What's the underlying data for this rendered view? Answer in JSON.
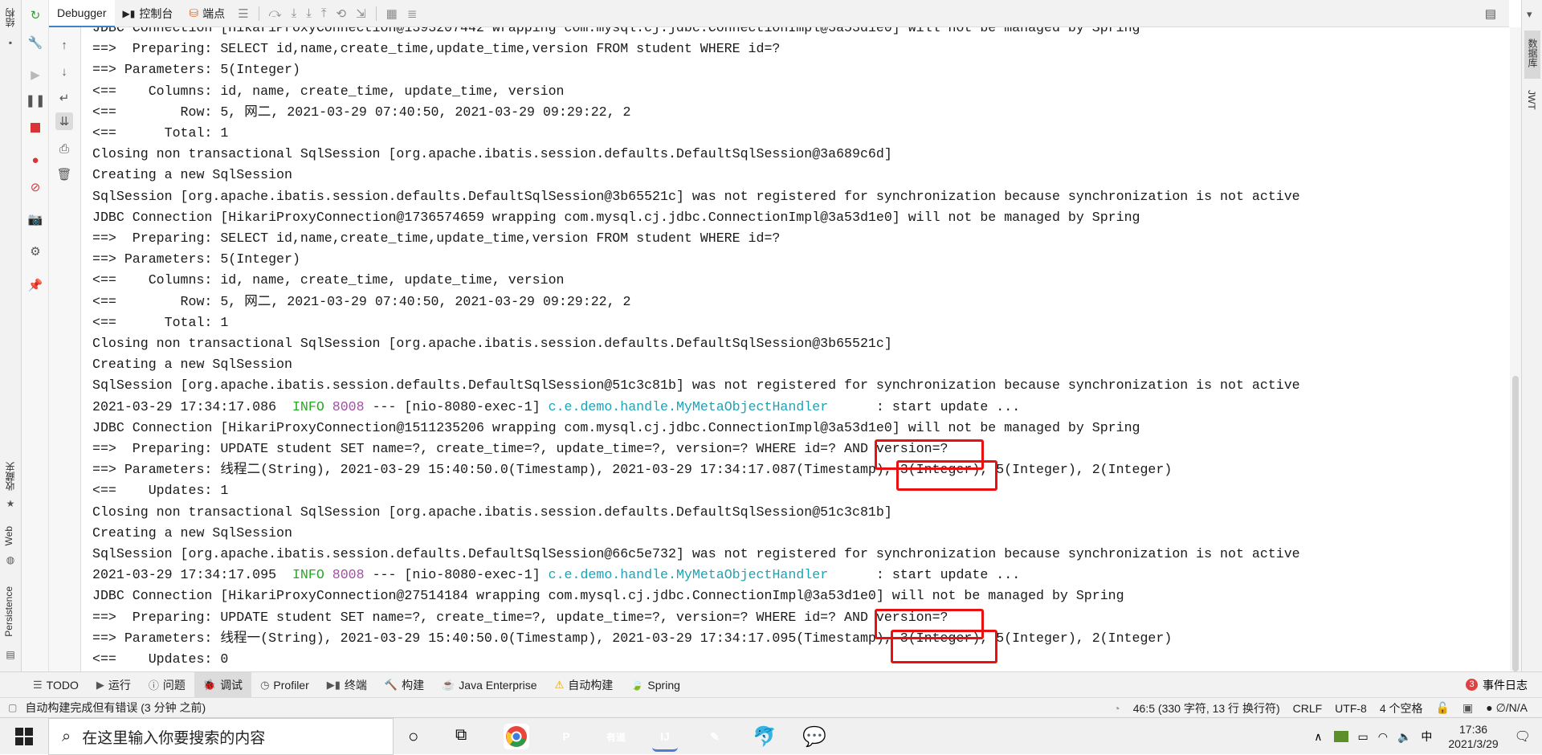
{
  "left_strip": {
    "top_label": "结构",
    "favorites_label": "收藏夹",
    "web_label": "Web",
    "persistence_label": "Persistence"
  },
  "debugger_tabs": {
    "debugger": "Debugger",
    "console": "控制台",
    "breakpoints": "端点"
  },
  "right_strip": {
    "database_label": "数据库",
    "jwt_label": "JWT"
  },
  "console_lines": [
    [
      {
        "t": "JDBC Connection [HikariProxyConnection@1393207442 wrapping com.mysql.cj.jdbc.ConnectionImpl@3a53d1e0] will not be managed by Spring"
      }
    ],
    [
      {
        "t": "==>  Preparing: SELECT id,name,create_time,update_time,version FROM student WHERE id=?"
      }
    ],
    [
      {
        "t": "==> Parameters: 5(Integer)"
      }
    ],
    [
      {
        "t": "<==    Columns: id, name, create_time, update_time, version"
      }
    ],
    [
      {
        "t": "<==        Row: 5, 网二, 2021-03-29 07:40:50, 2021-03-29 09:29:22, 2"
      }
    ],
    [
      {
        "t": "<==      Total: 1"
      }
    ],
    [
      {
        "t": "Closing non transactional SqlSession [org.apache.ibatis.session.defaults.DefaultSqlSession@3a689c6d]"
      }
    ],
    [
      {
        "t": "Creating a new SqlSession"
      }
    ],
    [
      {
        "t": "SqlSession [org.apache.ibatis.session.defaults.DefaultSqlSession@3b65521c] was not registered for synchronization because synchronization is not active"
      }
    ],
    [
      {
        "t": "JDBC Connection [HikariProxyConnection@1736574659 wrapping com.mysql.cj.jdbc.ConnectionImpl@3a53d1e0] will not be managed by Spring"
      }
    ],
    [
      {
        "t": "==>  Preparing: SELECT id,name,create_time,update_time,version FROM student WHERE id=?"
      }
    ],
    [
      {
        "t": "==> Parameters: 5(Integer)"
      }
    ],
    [
      {
        "t": "<==    Columns: id, name, create_time, update_time, version"
      }
    ],
    [
      {
        "t": "<==        Row: 5, 网二, 2021-03-29 07:40:50, 2021-03-29 09:29:22, 2"
      }
    ],
    [
      {
        "t": "<==      Total: 1"
      }
    ],
    [
      {
        "t": "Closing non transactional SqlSession [org.apache.ibatis.session.defaults.DefaultSqlSession@3b65521c]"
      }
    ],
    [
      {
        "t": "Creating a new SqlSession"
      }
    ],
    [
      {
        "t": "SqlSession [org.apache.ibatis.session.defaults.DefaultSqlSession@51c3c81b] was not registered for synchronization because synchronization is not active"
      }
    ],
    [
      {
        "t": "2021-03-29 17:34:17.086  "
      },
      {
        "t": "INFO",
        "c": "info"
      },
      {
        "t": " "
      },
      {
        "t": "8008",
        "c": "pid"
      },
      {
        "t": " --- [nio-8080-exec-1] "
      },
      {
        "t": "c.e.demo.handle.MyMetaObjectHandler",
        "c": "logger"
      },
      {
        "t": "      : start update ..."
      }
    ],
    [
      {
        "t": "JDBC Connection [HikariProxyConnection@1511235206 wrapping com.mysql.cj.jdbc.ConnectionImpl@3a53d1e0] will not be managed by Spring"
      }
    ],
    [
      {
        "t": "==>  Preparing: UPDATE student SET name=?, create_time=?, update_time=?, version=? WHERE id=? AND version=?"
      }
    ],
    [
      {
        "t": "==> Parameters: 线程二(String), 2021-03-29 15:40:50.0(Timestamp), 2021-03-29 17:34:17.087(Timestamp), 3(Integer), 5(Integer), 2(Integer)"
      }
    ],
    [
      {
        "t": "<==    Updates: 1"
      }
    ],
    [
      {
        "t": "Closing non transactional SqlSession [org.apache.ibatis.session.defaults.DefaultSqlSession@51c3c81b]"
      }
    ],
    [
      {
        "t": "Creating a new SqlSession"
      }
    ],
    [
      {
        "t": "SqlSession [org.apache.ibatis.session.defaults.DefaultSqlSession@66c5e732] was not registered for synchronization because synchronization is not active"
      }
    ],
    [
      {
        "t": "2021-03-29 17:34:17.095  "
      },
      {
        "t": "INFO",
        "c": "info"
      },
      {
        "t": " "
      },
      {
        "t": "8008",
        "c": "pid"
      },
      {
        "t": " --- [nio-8080-exec-1] "
      },
      {
        "t": "c.e.demo.handle.MyMetaObjectHandler",
        "c": "logger"
      },
      {
        "t": "      : start update ..."
      }
    ],
    [
      {
        "t": "JDBC Connection [HikariProxyConnection@27514184 wrapping com.mysql.cj.jdbc.ConnectionImpl@3a53d1e0] will not be managed by Spring"
      }
    ],
    [
      {
        "t": "==>  Preparing: UPDATE student SET name=?, create_time=?, update_time=?, version=? WHERE id=? AND version=?"
      }
    ],
    [
      {
        "t": "==> Parameters: 线程一(String), 2021-03-29 15:40:50.0(Timestamp), 2021-03-29 17:34:17.095(Timestamp), 3(Integer), 5(Integer), 2(Integer)"
      }
    ],
    [
      {
        "t": "<==    Updates: 0"
      }
    ]
  ],
  "bottom_tabs": [
    "TODO",
    "运行",
    "问题",
    "调试",
    "Profiler",
    "终端",
    "构建",
    "Java Enterprise",
    "自动构建",
    "Spring"
  ],
  "event_log": {
    "count": "3",
    "label": "事件日志"
  },
  "status_bar": {
    "message": "自动构建完成但有错误 (3 分钟 之前)",
    "position": "46:5 (330 字符, 13 行 换行符)",
    "line_sep": "CRLF",
    "encoding": "UTF-8",
    "indent": "4 个空格",
    "vcs": "∅/N/A"
  },
  "taskbar": {
    "search_placeholder": "在这里输入你要搜索的内容",
    "apps": [
      {
        "name": "chrome",
        "color": "#e8453c"
      },
      {
        "name": "pycharm",
        "label": "P",
        "color": "#1e88e5"
      },
      {
        "name": "youdao",
        "label": "有道",
        "color": "#e52525"
      },
      {
        "name": "intellij",
        "label": "IJ",
        "color": "#000000"
      },
      {
        "name": "postman",
        "color": "#ff6c37"
      },
      {
        "name": "docker",
        "color": "#7c8de6"
      },
      {
        "name": "wechat",
        "color": "#2dc100"
      }
    ],
    "time": "17:36",
    "date": "2021/3/29"
  }
}
